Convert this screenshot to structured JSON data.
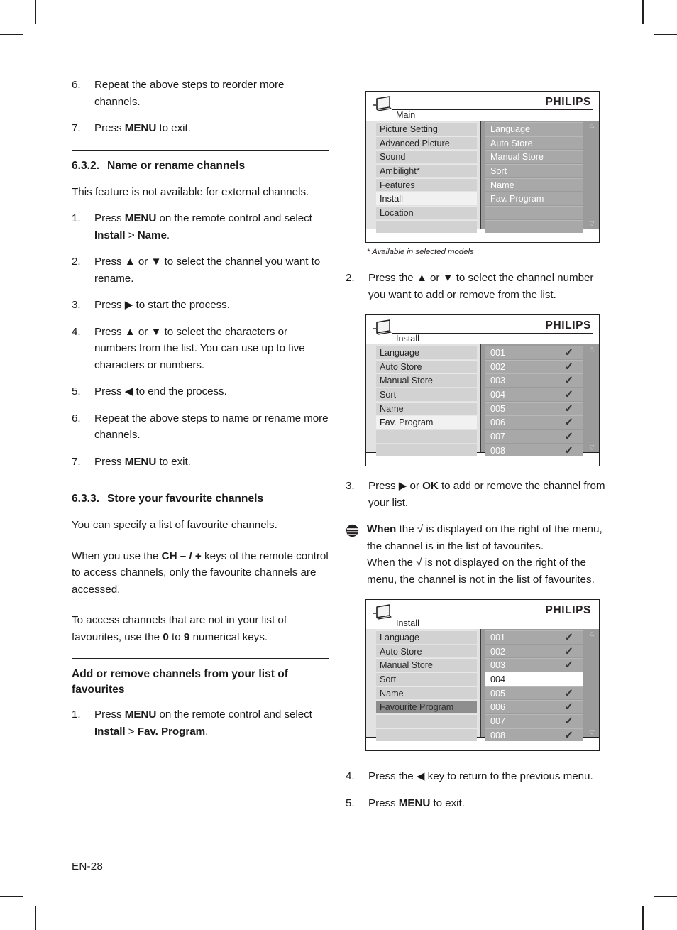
{
  "page": {
    "folio": "EN-28"
  },
  "left_column": {
    "steps_top": [
      {
        "num": "6.",
        "text": "Repeat the above steps to reorder more channels."
      },
      {
        "num": "7.",
        "text_pre": "Press ",
        "bold": "MENU",
        "text_post": " to exit."
      }
    ],
    "section_632": {
      "number": "6.3.2.",
      "title": "Name or rename channels",
      "intro": "This feature is not available for external channels.",
      "steps": [
        {
          "num": "1.",
          "pre": "Press ",
          "b1": "MENU",
          "mid": " on the remote control and select ",
          "b2": "Install",
          "mid2": " > ",
          "b3": "Name",
          "post": "."
        },
        {
          "num": "2.",
          "text": "Press ▲ or ▼ to select the channel you want to rename."
        },
        {
          "num": "3.",
          "text": "Press ▶ to start the process."
        },
        {
          "num": "4.",
          "text": "Press ▲ or ▼ to select the characters or numbers from the list. You can use up to five characters or numbers."
        },
        {
          "num": "5.",
          "text": "Press ◀ to end the process."
        },
        {
          "num": "6.",
          "text": "Repeat the above steps to name or rename more channels."
        },
        {
          "num": "7.",
          "pre": "Press ",
          "b1": "MENU",
          "post": " to exit."
        }
      ]
    },
    "section_633": {
      "number": "6.3.3.",
      "title": "Store your favourite channels",
      "para1": "You can specify a list of favourite channels.",
      "para2_pre": "When you use the ",
      "para2_bold": "CH – / +",
      "para2_post": " keys of the remote control to access channels, only the favourite channels are accessed.",
      "para3_pre": "To access channels that are not in your list of favourites, use the ",
      "para3_b1": "0",
      "para3_mid": " to ",
      "para3_b2": "9",
      "para3_post": " numerical keys."
    },
    "subsection_add_remove": {
      "title": "Add or remove channels from your list of favourites",
      "step1": {
        "num": "1.",
        "pre": "Press ",
        "b1": "MENU",
        "mid": " on the remote control and select ",
        "b2": "Install",
        "mid2": " > ",
        "b3": "Fav. Program",
        "post": "."
      }
    }
  },
  "right_column": {
    "menu_main": {
      "brand": "PHILIPS",
      "title": "Main",
      "left_items": [
        {
          "label": "Picture Setting",
          "state": "normal"
        },
        {
          "label": "Advanced Picture",
          "state": "normal"
        },
        {
          "label": "Sound",
          "state": "normal"
        },
        {
          "label": "Ambilight*",
          "state": "normal"
        },
        {
          "label": "Features",
          "state": "normal"
        },
        {
          "label": "Install",
          "state": "selected"
        },
        {
          "label": "Location",
          "state": "normal"
        },
        {
          "label": "",
          "state": "blank"
        }
      ],
      "right_items": [
        {
          "label": "Language",
          "state": "normal"
        },
        {
          "label": "Auto Store",
          "state": "normal"
        },
        {
          "label": "Manual Store",
          "state": "normal"
        },
        {
          "label": "Sort",
          "state": "normal"
        },
        {
          "label": "Name",
          "state": "normal"
        },
        {
          "label": "Fav. Program",
          "state": "normal"
        },
        {
          "label": "",
          "state": "blank"
        },
        {
          "label": "",
          "state": "blank"
        }
      ],
      "scroll_up": "△",
      "scroll_down": "▽"
    },
    "footnote": "* Available in selected models",
    "step2": {
      "num": "2.",
      "text": "Press the ▲ or ▼ to select the channel number you want to add or remove from the list."
    },
    "menu_install_1": {
      "brand": "PHILIPS",
      "title": "Install",
      "left_items": [
        {
          "label": "Language",
          "state": "normal"
        },
        {
          "label": "Auto Store",
          "state": "normal"
        },
        {
          "label": "Manual Store",
          "state": "normal"
        },
        {
          "label": "Sort",
          "state": "normal"
        },
        {
          "label": "Name",
          "state": "normal"
        },
        {
          "label": "Fav. Program",
          "state": "selected"
        },
        {
          "label": "",
          "state": "blank"
        },
        {
          "label": "",
          "state": "blank"
        }
      ],
      "right_items": [
        {
          "label": "001",
          "state": "normal",
          "tick": "✓"
        },
        {
          "label": "002",
          "state": "normal",
          "tick": "✓"
        },
        {
          "label": "003",
          "state": "normal",
          "tick": "✓"
        },
        {
          "label": "004",
          "state": "normal",
          "tick": "✓"
        },
        {
          "label": "005",
          "state": "normal",
          "tick": "✓"
        },
        {
          "label": "006",
          "state": "normal",
          "tick": "✓"
        },
        {
          "label": "007",
          "state": "normal",
          "tick": "✓"
        },
        {
          "label": "008",
          "state": "normal",
          "tick": "✓"
        }
      ],
      "scroll_up": "△",
      "scroll_down": "▽"
    },
    "step3": {
      "num": "3.",
      "pre": "Press ▶ or ",
      "b1": "OK",
      "post": " to add or remove the channel from your list."
    },
    "note": {
      "icon": "note-icon",
      "bold": "When",
      "text": " the √ is displayed on the right of the menu, the channel is in the list of favourites.",
      "text2": "When the √ is not displayed on the right of the menu, the channel is not in the list of favourites."
    },
    "menu_install_2": {
      "brand": "PHILIPS",
      "title": "Install",
      "left_items": [
        {
          "label": "Language",
          "state": "normal"
        },
        {
          "label": "Auto Store",
          "state": "normal"
        },
        {
          "label": "Manual Store",
          "state": "normal"
        },
        {
          "label": "Sort",
          "state": "normal"
        },
        {
          "label": "Name",
          "state": "normal"
        },
        {
          "label": "Favourite Program",
          "state": "selected-dark"
        },
        {
          "label": "",
          "state": "blank"
        },
        {
          "label": "",
          "state": "blank"
        }
      ],
      "right_items": [
        {
          "label": "001",
          "state": "normal",
          "tick": "✓"
        },
        {
          "label": "002",
          "state": "normal",
          "tick": "✓"
        },
        {
          "label": "003",
          "state": "normal",
          "tick": "✓"
        },
        {
          "label": "004",
          "state": "selected-white",
          "tick": ""
        },
        {
          "label": "005",
          "state": "normal",
          "tick": "✓"
        },
        {
          "label": "006",
          "state": "normal",
          "tick": "✓"
        },
        {
          "label": "007",
          "state": "normal",
          "tick": "✓"
        },
        {
          "label": "008",
          "state": "normal",
          "tick": "✓"
        }
      ],
      "scroll_up": "△",
      "scroll_down": "▽"
    },
    "step4": {
      "num": "4.",
      "text": "Press the ◀ key to return to the previous menu."
    },
    "step5": {
      "num": "5.",
      "pre": "Press ",
      "b1": "MENU",
      "post": " to exit."
    }
  },
  "colors": {
    "ink": "#231f20",
    "panel_left_bg": "#e2e2e2",
    "panel_left_row": "#d2d2d2",
    "panel_right_bg": "#9b9b9b",
    "panel_right_row": "#a8a8a8",
    "highlight_white": "#f1f1f1"
  }
}
